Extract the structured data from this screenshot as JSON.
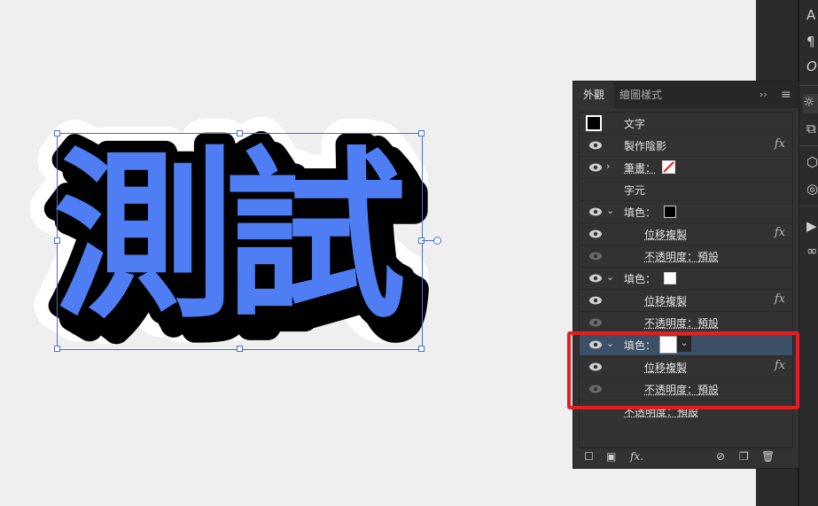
{
  "artwork": {
    "text": "測試",
    "fill_color": "#4e7df4",
    "shadow_color": "#000000",
    "halo_color": "#ffffff"
  },
  "panel": {
    "tabs": [
      {
        "label": "外觀"
      },
      {
        "label": "繪圖樣式"
      }
    ],
    "menu_glyph": "≡",
    "collapse_glyph": "››",
    "rows": [
      {
        "label": "文字"
      },
      {
        "label": "製作陰影",
        "fx": "fx"
      },
      {
        "label": "筆畫："
      },
      {
        "label": "字元"
      },
      {
        "label": "填色："
      },
      {
        "label": "位移複製",
        "fx": "fx"
      },
      {
        "label": "不透明度：預設"
      },
      {
        "label": "填色："
      },
      {
        "label": "位移複製",
        "fx": "fx"
      },
      {
        "label": "不透明度：預設"
      },
      {
        "label": "填色："
      },
      {
        "label": "位移複製",
        "fx": "fx"
      },
      {
        "label": "不透明度：預設"
      },
      {
        "label": "不透明度：預設"
      }
    ],
    "colors": {
      "selected_row": "#3c4f66",
      "highlight_box": "#e41e23"
    },
    "bottom_icons": [
      "new-stroke-icon",
      "new-fill-icon",
      "fx-icon",
      "clear-icon",
      "duplicate-icon",
      "trash-icon"
    ]
  },
  "tools": [
    "type-icon",
    "paragraph-icon",
    "glyph-icon",
    "sun-icon",
    "transform-icon",
    "3d-icon",
    "link-icon"
  ]
}
